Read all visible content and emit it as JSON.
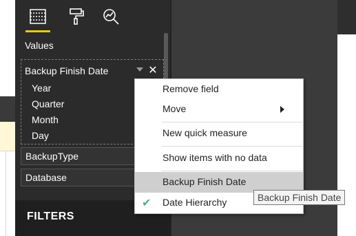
{
  "pane": {
    "tabs": [
      {
        "icon": "fields-grid-icon"
      },
      {
        "icon": "paint-roller-icon"
      },
      {
        "icon": "analytics-magnifier-icon"
      }
    ],
    "values_label": "Values",
    "well": {
      "header": "Backup Finish Date",
      "sub_items": [
        "Year",
        "Quarter",
        "Month",
        "Day"
      ]
    },
    "fields": [
      "BackupType",
      "Database"
    ],
    "filters_header": "FILTERS"
  },
  "context_menu": {
    "items": [
      {
        "label": "Remove field"
      },
      {
        "label": "Move",
        "has_submenu": true
      },
      {
        "label": "New quick measure"
      },
      {
        "label": "Show items with no data"
      },
      {
        "label": "Backup Finish Date",
        "highlighted": true
      },
      {
        "label": "Date Hierarchy",
        "checked": true
      }
    ]
  },
  "tooltip": "Backup Finish Date",
  "colors": {
    "accent": "#f2c811",
    "check": "#4caf81",
    "pane_bg": "#2b2b2b",
    "menu_highlight": "#cfcfcf"
  }
}
